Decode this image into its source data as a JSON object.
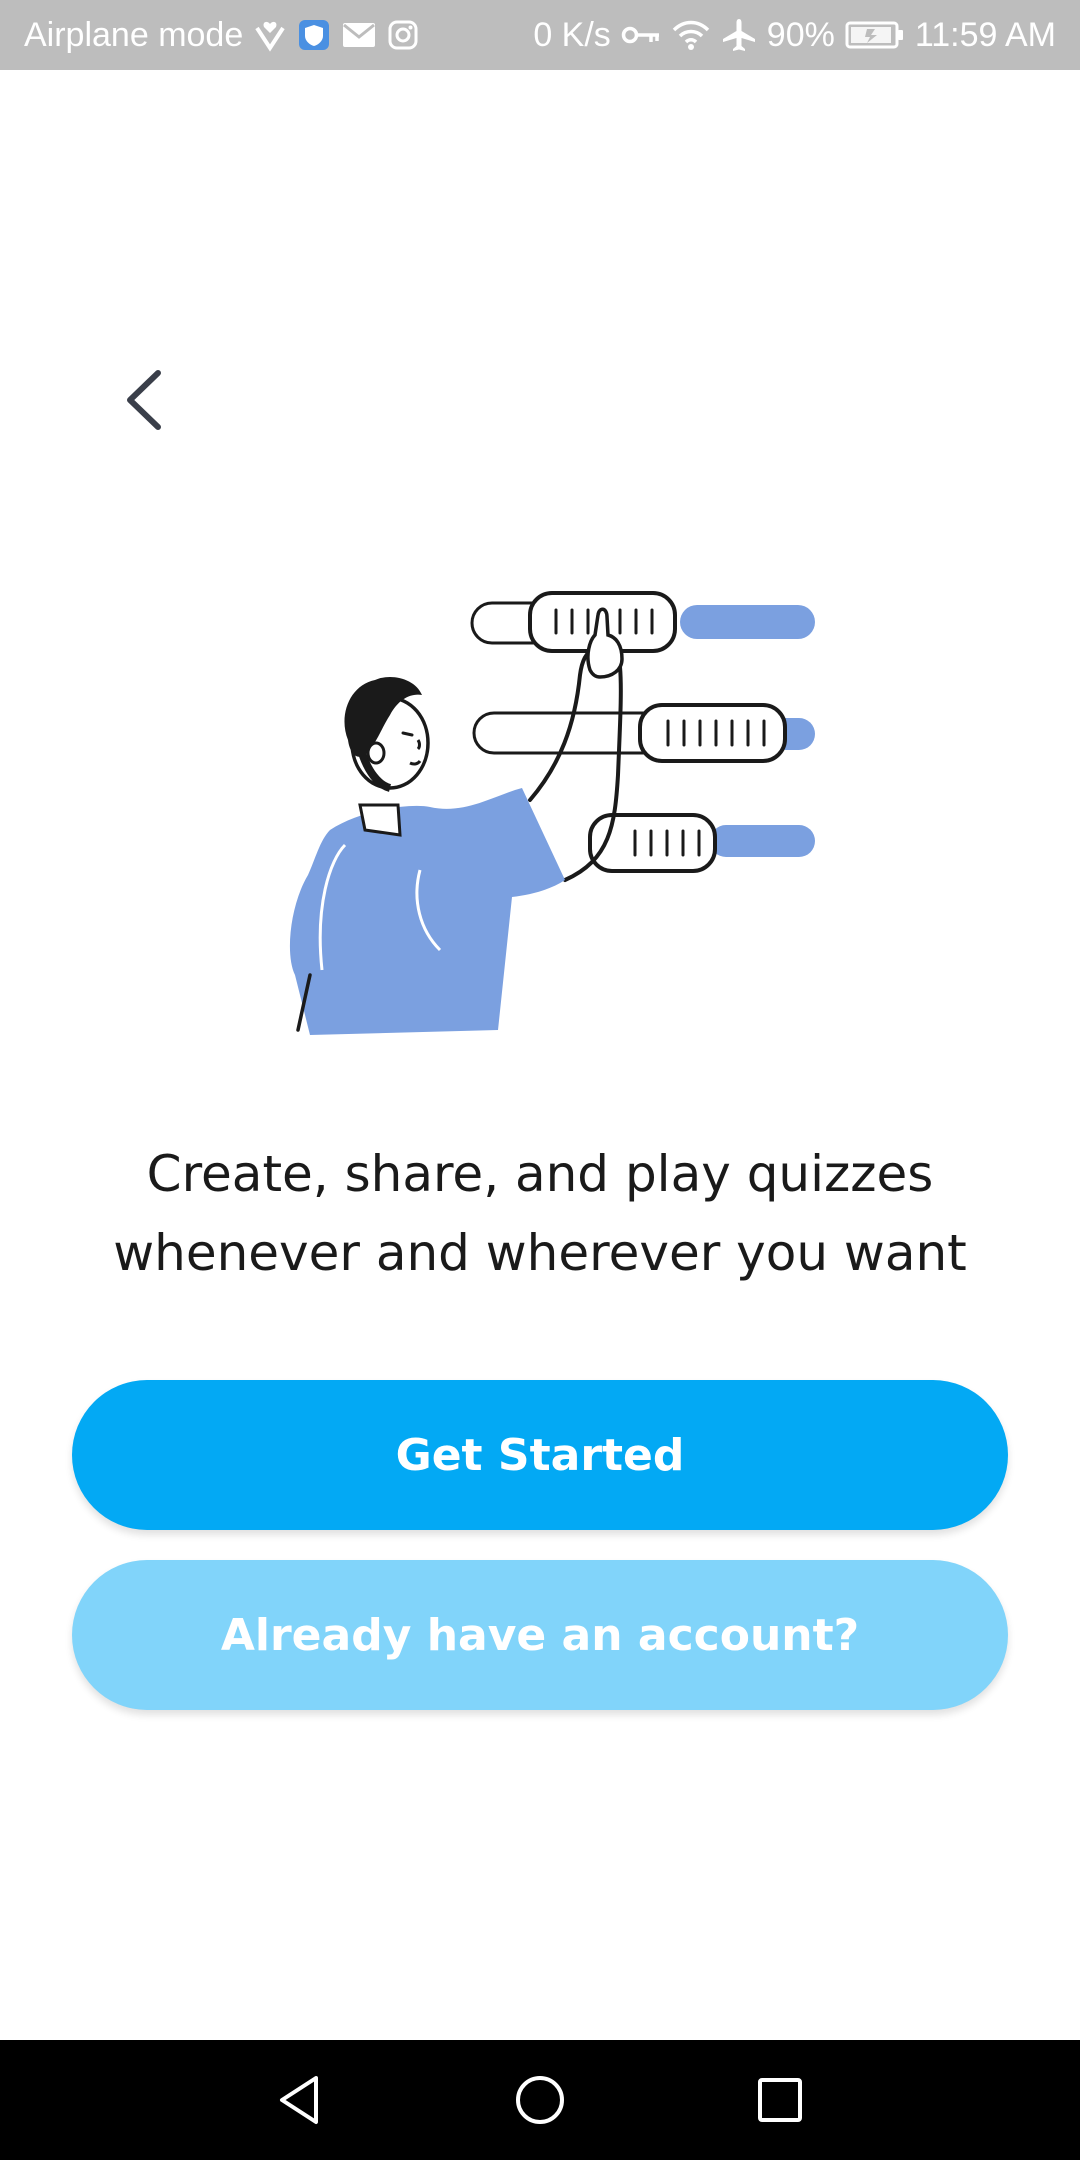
{
  "status_bar": {
    "mode_label": "Airplane mode",
    "net_speed": "0 K/s",
    "battery": "90%",
    "time": "11:59 AM",
    "icons_left": [
      "check-heart-icon",
      "shield-icon",
      "mail-icon",
      "instagram-icon"
    ],
    "icons_right": [
      "key-icon",
      "wifi-icon",
      "airplane-icon",
      "battery-icon"
    ]
  },
  "header": {
    "back_icon": "chevron-left-icon"
  },
  "illustration": {
    "name": "person-adjusting-sliders-illustration",
    "accent_color": "#7ba0e0"
  },
  "content": {
    "headline_line1": "Create, share, and play quizzes",
    "headline_line2": "whenever and wherever you want"
  },
  "buttons": {
    "get_started": "Get Started",
    "already_account": "Already have an account?"
  },
  "colors": {
    "primary": "#03a9f4",
    "secondary": "#81d4fa",
    "status_bar": "#bdbdbd",
    "nav_bar": "#000000"
  },
  "nav_bar": {
    "icons": [
      "back-triangle-icon",
      "home-circle-icon",
      "recents-square-icon"
    ]
  }
}
